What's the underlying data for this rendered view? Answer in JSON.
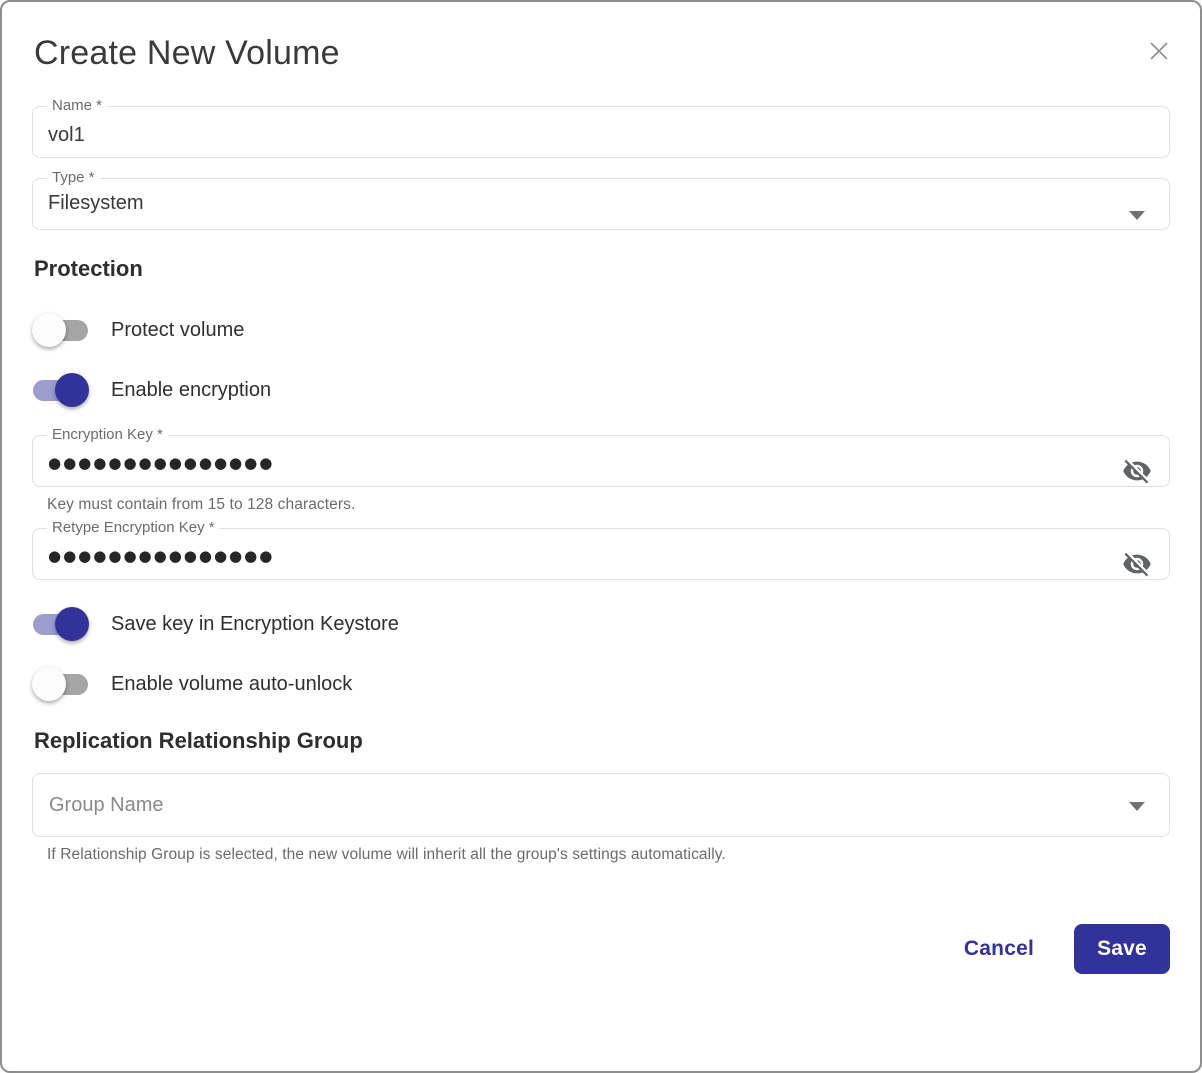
{
  "dialog": {
    "title": "Create New Volume"
  },
  "fields": {
    "name": {
      "label": "Name *",
      "value": "vol1"
    },
    "type": {
      "label": "Type *",
      "value": "Filesystem"
    },
    "encryption_key": {
      "label": "Encryption Key *",
      "masked_value": "●●●●●●●●●●●●●●●",
      "helper": "Key must contain from 15 to 128 characters."
    },
    "retype_encryption_key": {
      "label": "Retype Encryption Key *",
      "masked_value": "●●●●●●●●●●●●●●●"
    },
    "group_name": {
      "placeholder": "Group Name",
      "helper": "If Relationship Group is selected, the new volume will inherit all the group's settings automatically."
    }
  },
  "sections": {
    "protection": "Protection",
    "replication": "Replication Relationship Group"
  },
  "toggles": [
    {
      "label": "Protect volume",
      "state": "off"
    },
    {
      "label": "Enable encryption",
      "state": "on"
    },
    {
      "label": "Save key in Encryption Keystore",
      "state": "on"
    },
    {
      "label": "Enable volume auto-unlock",
      "state": "off"
    }
  ],
  "buttons": {
    "cancel": "Cancel",
    "save": "Save"
  },
  "colors": {
    "primary": "#32329B",
    "toggle_track_on": "#9B9DCF",
    "toggle_track_off": "#A5A5A5",
    "field_border": "#E0E0E0",
    "text_dark": "#3A3A3A",
    "text_muted": "#6B6B6B"
  }
}
